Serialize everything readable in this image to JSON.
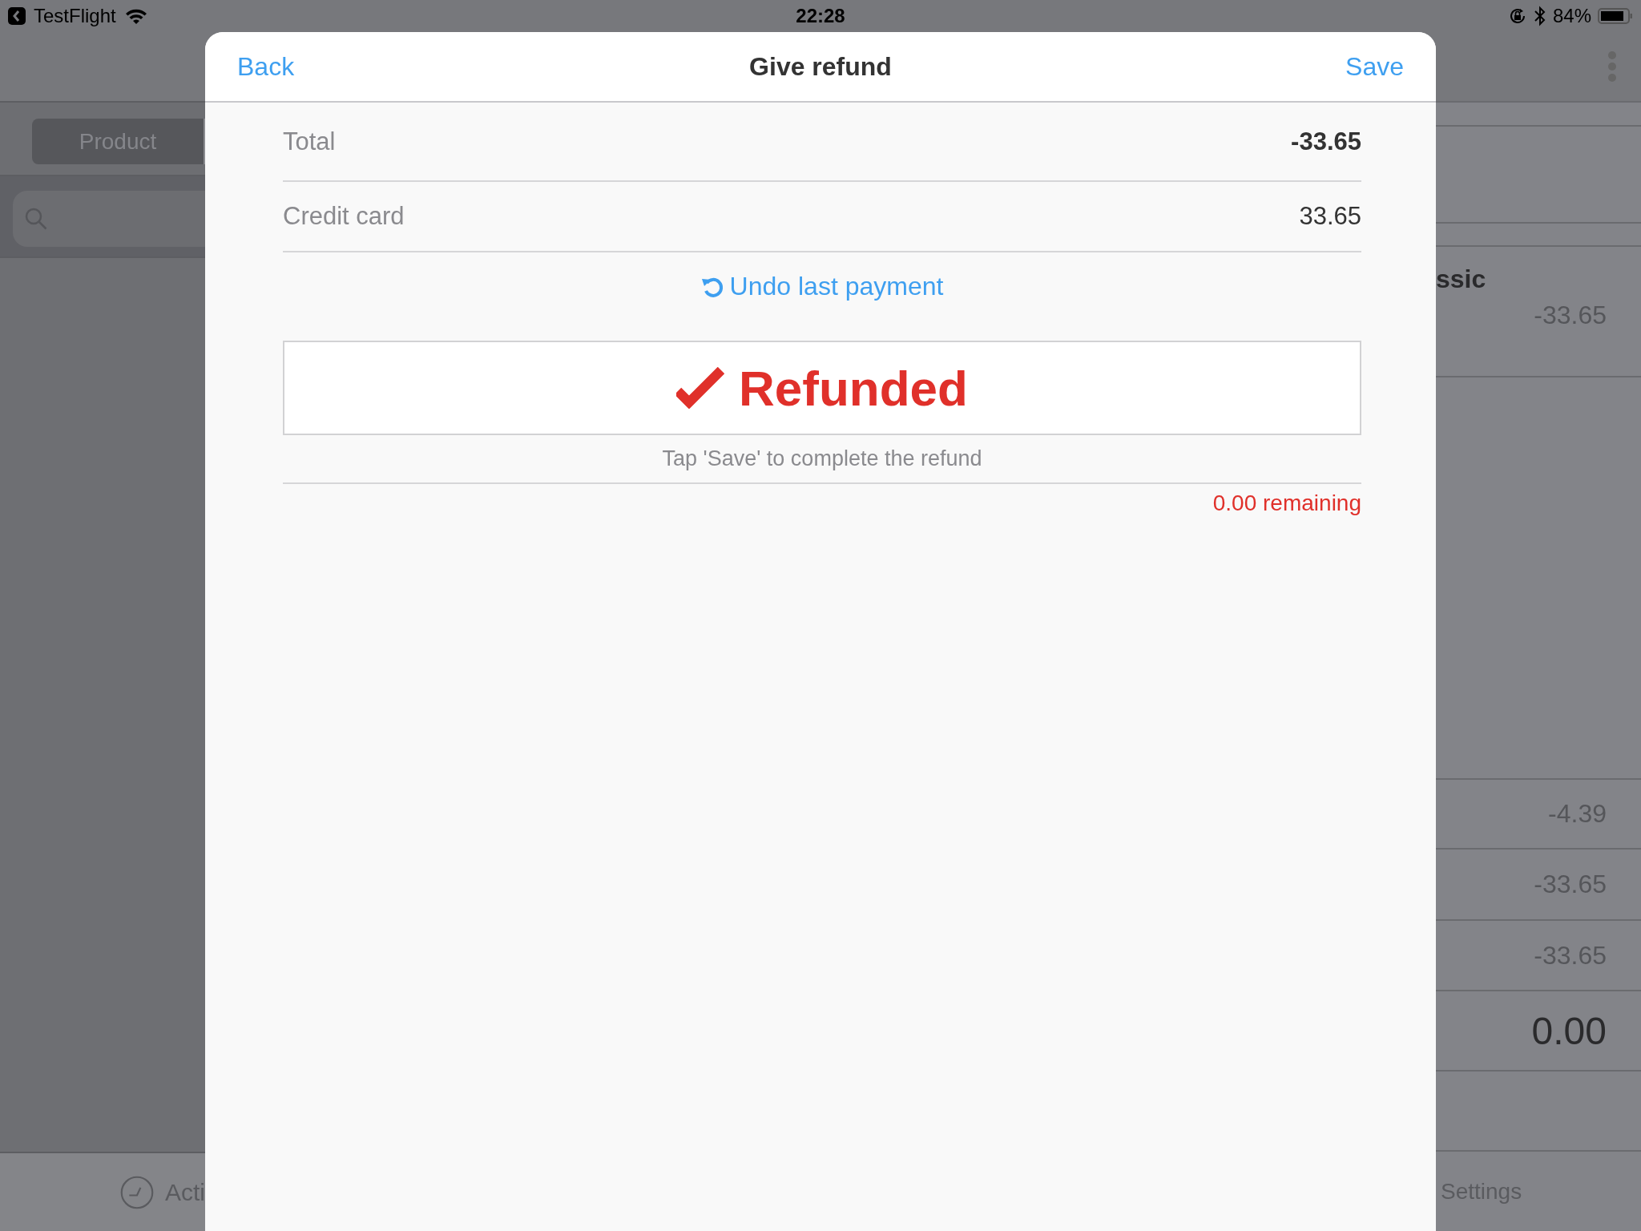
{
  "status_bar": {
    "app": "TestFlight",
    "time": "22:28",
    "battery": "84%"
  },
  "background": {
    "left": {
      "segment": "Product",
      "tab": "Acti"
    },
    "right": {
      "title": "ssic",
      "amount": "-33.65",
      "rows": [
        "-4.39",
        "-33.65",
        "-33.65"
      ],
      "total": "0.00",
      "tab": "Settings"
    }
  },
  "modal": {
    "title": "Give refund",
    "back": "Back",
    "save": "Save",
    "rows": [
      {
        "kind": "total",
        "label": "Total",
        "value": "-33.65"
      },
      {
        "kind": "payment",
        "label": "Credit card",
        "value": "33.65"
      }
    ],
    "undo": "Undo last payment",
    "status": "Refunded",
    "hint": "Tap 'Save' to complete the refund",
    "remaining": "0.00 remaining"
  }
}
